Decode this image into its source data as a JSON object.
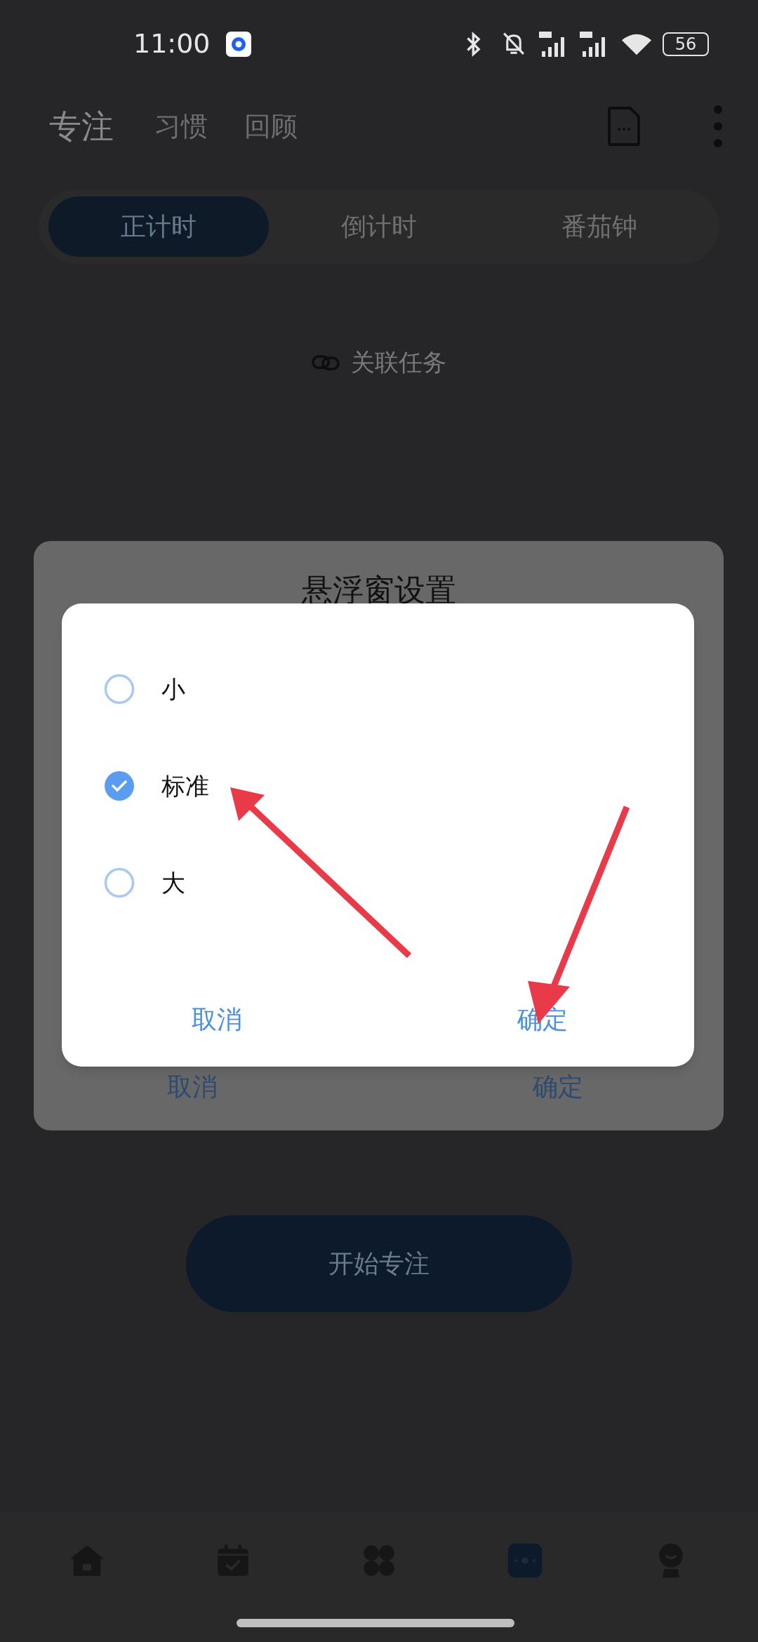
{
  "status_bar": {
    "time": "11:00",
    "battery": "56"
  },
  "header_tabs": [
    {
      "label": "专注",
      "selected": true
    },
    {
      "label": "习惯",
      "selected": false
    },
    {
      "label": "回顾",
      "selected": false
    }
  ],
  "mode_tabs": [
    {
      "label": "正计时",
      "selected": true
    },
    {
      "label": "倒计时",
      "selected": false
    },
    {
      "label": "番茄钟",
      "selected": false
    }
  ],
  "link_task": "关联任务",
  "start_button": "开始专注",
  "bottom_nav": [
    {
      "selected": false
    },
    {
      "selected": false
    },
    {
      "selected": false
    },
    {
      "selected": true
    },
    {
      "selected": false
    }
  ],
  "floating_window_dialog": {
    "title": "悬浮窗设置",
    "buttons": [
      "取消",
      "确定"
    ]
  },
  "size_dialog": {
    "options": [
      {
        "label": "小",
        "selected": false
      },
      {
        "label": "标准",
        "selected": true
      },
      {
        "label": "大",
        "selected": false
      }
    ],
    "buttons": [
      "取消",
      "确定"
    ]
  }
}
